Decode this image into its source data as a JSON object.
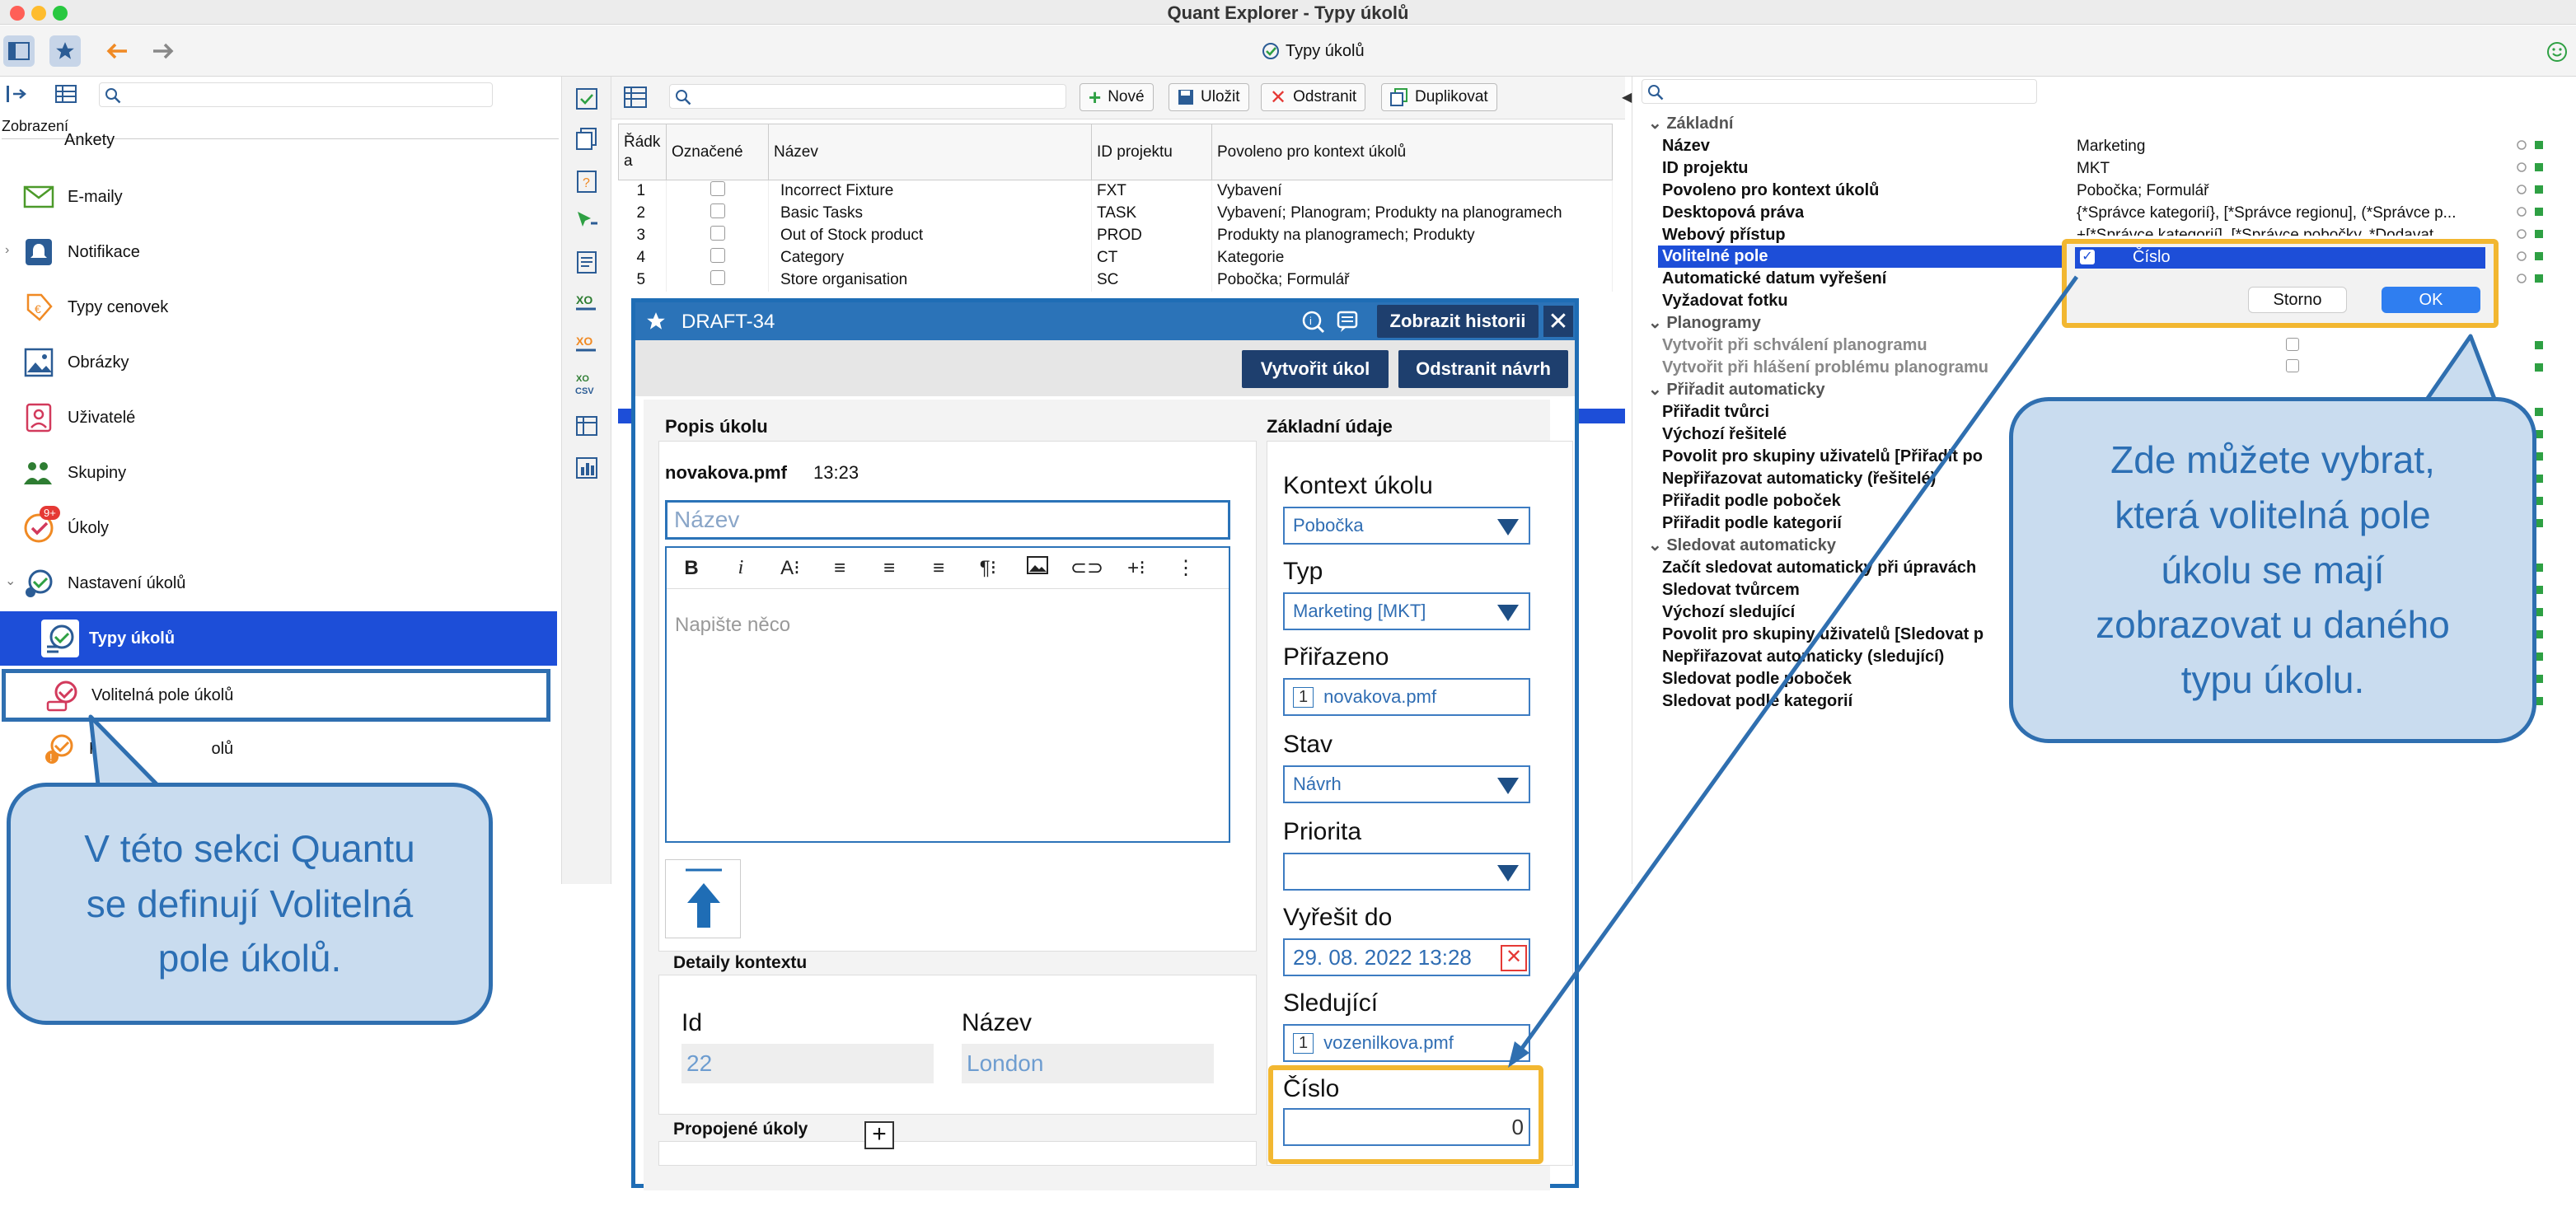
{
  "window": {
    "title": "Quant Explorer - Typy úkolů",
    "tab_title": "Typy úkolů"
  },
  "toolbar": {
    "back_icon": "arrow-left-icon",
    "forward_icon": "arrow-right-icon"
  },
  "left": {
    "section_label": "Zobrazení",
    "items": [
      {
        "label": "Ankety"
      },
      {
        "label": "E-maily"
      },
      {
        "label": "Notifikace"
      },
      {
        "label": "Typy cenovek"
      },
      {
        "label": "Obrázky"
      },
      {
        "label": "Uživatelé"
      },
      {
        "label": "Skupiny"
      },
      {
        "label": "Úkoly",
        "badge": "9+"
      },
      {
        "label": "Nastavení úkolů"
      },
      {
        "label": "Typy úkolů"
      },
      {
        "label": "Volitelná pole úkolů"
      },
      {
        "label": "Priority úkolů",
        "visible": "Pri",
        "visible_tail": "olů"
      }
    ]
  },
  "middle": {
    "buttons": {
      "new": "Nové",
      "save": "Uložit",
      "delete": "Odstranit",
      "duplicate": "Duplikovat"
    },
    "columns": [
      "Řádka",
      "Označené",
      "Název",
      "ID projektu",
      "Povoleno pro kontext úkolů"
    ],
    "col_row_line1": "Řádk",
    "col_row_line2": "a",
    "rows": [
      {
        "n": "1",
        "name": "Incorrect Fixture",
        "id": "FXT",
        "ctx": "Vybavení"
      },
      {
        "n": "2",
        "name": "Basic Tasks",
        "id": "TASK",
        "ctx": "Vybavení; Planogram; Produkty na planogramech"
      },
      {
        "n": "3",
        "name": "Out of Stock product",
        "id": "PROD",
        "ctx": "Produkty na planogramech; Produkty"
      },
      {
        "n": "4",
        "name": "Category",
        "id": "CT",
        "ctx": "Kategorie"
      },
      {
        "n": "5",
        "name": "Store organisation",
        "id": "SC",
        "ctx": "Pobočka; Formulář"
      }
    ]
  },
  "dialog": {
    "title": "DRAFT-34",
    "history_button": "Zobrazit historii",
    "create_button": "Vytvořit úkol",
    "remove_button": "Odstranit návrh",
    "description_section": "Popis úkolu",
    "author": "novakova.pmf",
    "time": "13:23",
    "title_placeholder": "Název",
    "editor_placeholder": "Napište něco",
    "context_section": "Detaily kontextu",
    "ctx_id_label": "Id",
    "ctx_id_value": "22",
    "ctx_name_label": "Název",
    "ctx_name_value": "London",
    "linked_section": "Propojené úkoly",
    "basic_section": "Základní údaje",
    "fields": {
      "context_label": "Kontext úkolu",
      "context_value": "Pobočka",
      "type_label": "Typ",
      "type_value": "Marketing [MKT]",
      "assigned_label": "Přiřazeno",
      "assigned_count": "1",
      "assigned_value": "novakova.pmf",
      "state_label": "Stav",
      "state_value": "Návrh",
      "priority_label": "Priorita",
      "priority_value": "",
      "due_label": "Vyřešit do",
      "due_value": "29. 08. 2022 13:28",
      "watchers_label": "Sledující",
      "watchers_count": "1",
      "watchers_value": "vozenilkova.pmf",
      "number_label": "Číslo",
      "number_value": "0"
    }
  },
  "right": {
    "groups": {
      "basic": "Základní",
      "planograms": "Planogramy",
      "assign_auto": "Přiřadit automaticky",
      "follow_auto": "Sledovat automaticky"
    },
    "props": {
      "name": "Název",
      "name_v": "Marketing",
      "project": "ID projektu",
      "project_v": "MKT",
      "allowed": "Povoleno pro kontext úkolů",
      "allowed_v": "Pobočka; Formulář",
      "desktop": "Desktopová práva",
      "desktop_v": "{*Správce kategorií}, [*Správce regionu], (*Správce p...",
      "web": "Webový přístup",
      "web_v": "+[*Správce kategorií], [*Správce pobočky, *Dodavat...",
      "optional": "Volitelné pole",
      "autodate": "Automatické datum vyřešení",
      "photo": "Vyžadovat fotku",
      "plan_approve": "Vytvořit při schválení planogramu",
      "plan_issue": "Vytvořit při hlášení problému planogramu",
      "assign_creator": "Přiřadit tvůrci",
      "default_solver": "Výchozí řešitelé",
      "allow_groups_assign": "Povolit pro skupiny uživatelů [Přiřadit po",
      "no_auto_assign": "Nepřiřazovat automaticky (řešitelé)",
      "assign_branches": "Přiřadit podle poboček",
      "assign_categories": "Přiřadit podle kategorií",
      "follow_on_edit": "Začít sledovat automaticky při úpravách",
      "follow_creator": "Sledovat tvůrcem",
      "default_followers": "Výchozí sledující",
      "allow_groups_follow": "Povolit pro skupiny uživatelů [Sledovat p",
      "no_auto_follow": "Nepřiřazovat automaticky (sledující)",
      "follow_branches": "Sledovat podle poboček",
      "follow_categories": "Sledovat podle kategorií"
    },
    "popup": {
      "option": "Číslo",
      "cancel": "Storno",
      "ok": "OK"
    }
  },
  "callouts": {
    "left_line1": "V této sekci Quantu",
    "left_line2": "se definují Volitelná",
    "left_line3": "pole úkolů.",
    "right_line1": "Zde můžete vybrat,",
    "right_line2": "která volitelná pole",
    "right_line3": "úkolu se mají",
    "right_line4": "zobrazovat u daného",
    "right_line5": "typu úkolu."
  },
  "colors": {
    "accent": "#1d4ed8",
    "dialog_blue": "#2b73b8",
    "highlight": "#f2b731",
    "callout_fill": "#c9dcef"
  }
}
